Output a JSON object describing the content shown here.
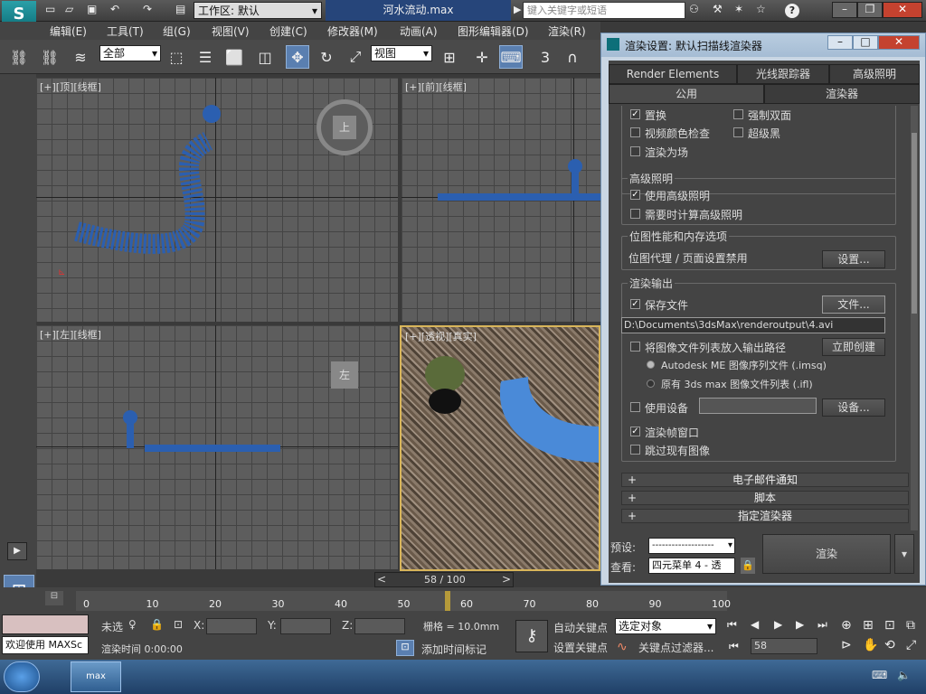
{
  "title": {
    "workspace_label": "工作区: 默认",
    "filename": "河水流动.max",
    "search_placeholder": "键入关键字或短语",
    "help": "?"
  },
  "menu": [
    "编辑(E)",
    "工具(T)",
    "组(G)",
    "视图(V)",
    "创建(C)",
    "修改器(M)",
    "动画(A)",
    "图形编辑器(D)",
    "渲染(R)"
  ],
  "toolbar": {
    "selection_filter": "全部",
    "ref_coord": "视图",
    "snap_label": "3"
  },
  "viewports": {
    "top": "[+][顶][线框]",
    "front": "[+][前][线框]",
    "left": "[+][左][线框]",
    "persp": "[+][透视][真实]",
    "viewcube_top": "上",
    "viewcube_left": "左"
  },
  "dialog": {
    "title": "渲染设置: 默认扫描线渲染器",
    "tabs_row1": [
      "Render Elements",
      "光线跟踪器",
      "高级照明"
    ],
    "tabs_row2": [
      "公用",
      "渲染器"
    ],
    "options": {
      "cut1": "置换",
      "cut2": "强制双面",
      "video_color_check": "视频颜色检查",
      "super_black": "超级黑",
      "render_to_fields": "渲染为场"
    },
    "adv_lighting": {
      "title": "高级照明",
      "use": "使用高级照明",
      "compute": "需要时计算高级照明"
    },
    "bitmap": {
      "title": "位图性能和内存选项",
      "desc": "位图代理 / 页面设置禁用",
      "settings": "设置..."
    },
    "render_output": {
      "title": "渲染输出",
      "save_file": "保存文件",
      "files_btn": "文件...",
      "path": "D:\\Documents\\3dsMax\\renderoutput\\4.avi",
      "put_list": "将图像文件列表放入输出路径",
      "create_now": "立即创建",
      "autodesk_seq": "Autodesk ME 图像序列文件 (.imsq)",
      "legacy_list": "原有 3ds max 图像文件列表 (.ifl)",
      "use_device": "使用设备",
      "device_btn": "设备...",
      "frame_window": "渲染帧窗口",
      "skip_existing": "跳过现有图像"
    },
    "rollouts": [
      "电子邮件通知",
      "脚本",
      "指定渲染器"
    ],
    "preset_label": "预设:",
    "preset_value": "-------------------",
    "view_label": "查看:",
    "view_value": "四元菜单 4 - 透",
    "render_btn": "渲染"
  },
  "timeline": {
    "frame": "58 / 100",
    "ticks": [
      "0",
      "10",
      "20",
      "30",
      "40",
      "50",
      "60",
      "70",
      "80",
      "90",
      "100"
    ],
    "current": 58
  },
  "status": {
    "welcome": "欢迎使用 MAXSc",
    "lock_label": "未选",
    "x": "X:",
    "y": "Y:",
    "z": "Z:",
    "grid": "栅格 = 10.0mm",
    "auto_key": "自动关键点",
    "set_key": "设置关键点",
    "key_mode": "选定对象",
    "key_filter": "关键点过滤器...",
    "render_time": "渲染时间 0:00:00",
    "add_time_tag": "添加时间标记",
    "frame_field": "58"
  },
  "taskbar": {
    "app": "max"
  }
}
